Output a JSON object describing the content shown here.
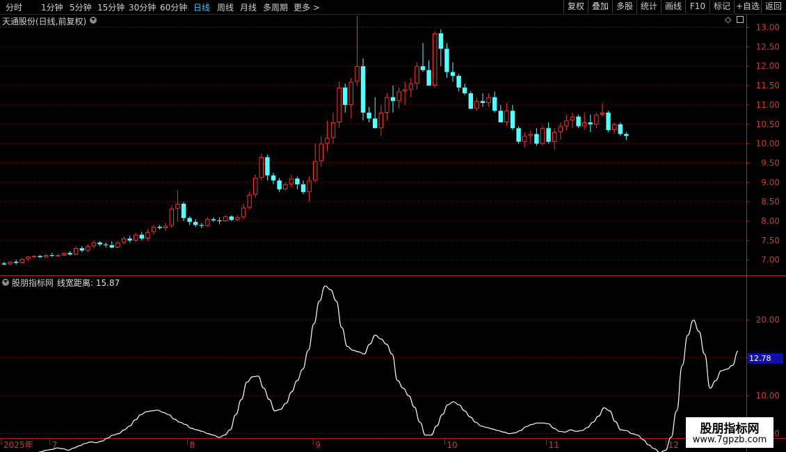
{
  "toolbar": {
    "periods": [
      "分时",
      "1分钟",
      "5分钟",
      "15分钟",
      "30分钟",
      "60分钟",
      "日线",
      "周线",
      "月线",
      "多周期",
      "更多 >"
    ],
    "active_period": "日线",
    "right_buttons": [
      "复权",
      "叠加",
      "多股",
      "统计",
      "画线",
      "F10",
      "标记",
      "+自选",
      "返回"
    ]
  },
  "main_panel": {
    "title": "天通股份(日线,前复权)",
    "collapse_icon": "chevron-down-icon",
    "icons": [
      "diamond-icon",
      "panel-toggle-icon"
    ]
  },
  "indicator_panel": {
    "title": "股朋指标网",
    "param_label": "线宽距离: 15.87",
    "badge_value": "12.78"
  },
  "watermark": {
    "title": "股朋指标网",
    "url": "www.7gpzb.com"
  },
  "colors": {
    "up": "#ff3232",
    "down": "#54ffff",
    "line": "#ffffff",
    "grid": "#8a1c1c",
    "axis": "#b32020",
    "label": "#cc3b3b",
    "badge_bg": "#1010a8"
  },
  "chart_data": [
    {
      "type": "candlestick",
      "title": "天通股份(日线,前复权)",
      "ylim": [
        6.6,
        13.35
      ],
      "y_ticks": [
        "7.00",
        "7.50",
        "8.00",
        "8.50",
        "9.00",
        "9.50",
        "10.00",
        "10.50",
        "11.00",
        "11.50",
        "12.00",
        "12.50",
        "13.00"
      ],
      "x_labels": [
        {
          "i": 0,
          "t": "2025年"
        },
        {
          "i": 8,
          "t": "7"
        },
        {
          "i": 31,
          "t": "8"
        },
        {
          "i": 52,
          "t": "9"
        },
        {
          "i": 74,
          "t": "10"
        },
        {
          "i": 91,
          "t": "11"
        },
        {
          "i": 111,
          "t": "12"
        }
      ],
      "ohlc": [
        [
          6.91,
          6.95,
          6.86,
          6.88
        ],
        [
          6.89,
          6.97,
          6.86,
          6.95
        ],
        [
          6.95,
          7.0,
          6.88,
          6.92
        ],
        [
          6.92,
          7.05,
          6.9,
          7.02
        ],
        [
          7.02,
          7.1,
          6.98,
          7.08
        ],
        [
          7.08,
          7.12,
          7.05,
          7.1
        ],
        [
          7.1,
          7.13,
          7.05,
          7.07
        ],
        [
          7.07,
          7.15,
          7.05,
          7.12
        ],
        [
          7.12,
          7.18,
          7.08,
          7.1
        ],
        [
          7.1,
          7.16,
          7.08,
          7.12
        ],
        [
          7.12,
          7.2,
          7.1,
          7.18
        ],
        [
          7.18,
          7.22,
          7.12,
          7.14
        ],
        [
          7.14,
          7.35,
          7.12,
          7.3
        ],
        [
          7.3,
          7.35,
          7.2,
          7.24
        ],
        [
          7.24,
          7.4,
          7.2,
          7.35
        ],
        [
          7.35,
          7.5,
          7.3,
          7.45
        ],
        [
          7.45,
          7.48,
          7.35,
          7.4
        ],
        [
          7.4,
          7.45,
          7.32,
          7.38
        ],
        [
          7.38,
          7.48,
          7.3,
          7.32
        ],
        [
          7.32,
          7.48,
          7.3,
          7.45
        ],
        [
          7.45,
          7.6,
          7.4,
          7.55
        ],
        [
          7.55,
          7.62,
          7.45,
          7.5
        ],
        [
          7.5,
          7.7,
          7.45,
          7.65
        ],
        [
          7.65,
          7.72,
          7.5,
          7.55
        ],
        [
          7.55,
          7.8,
          7.5,
          7.72
        ],
        [
          7.72,
          7.9,
          7.65,
          7.85
        ],
        [
          7.85,
          7.9,
          7.78,
          7.82
        ],
        [
          7.82,
          7.95,
          7.75,
          7.88
        ],
        [
          7.88,
          8.4,
          7.82,
          8.32
        ],
        [
          8.32,
          8.8,
          8.0,
          8.45
        ],
        [
          8.45,
          8.5,
          8.0,
          8.08
        ],
        [
          8.08,
          8.12,
          7.9,
          7.98
        ],
        [
          7.98,
          8.05,
          7.85,
          7.9
        ],
        [
          7.9,
          7.95,
          7.82,
          7.88
        ],
        [
          7.88,
          8.1,
          7.85,
          8.05
        ],
        [
          8.05,
          8.1,
          7.98,
          8.02
        ],
        [
          8.02,
          8.1,
          7.92,
          8.0
        ],
        [
          8.0,
          8.15,
          7.98,
          8.12
        ],
        [
          8.12,
          8.15,
          8.0,
          8.03
        ],
        [
          8.03,
          8.15,
          8.0,
          8.1
        ],
        [
          8.1,
          8.45,
          8.05,
          8.35
        ],
        [
          8.35,
          8.75,
          8.3,
          8.68
        ],
        [
          8.68,
          9.2,
          8.6,
          9.12
        ],
        [
          9.12,
          9.75,
          9.05,
          9.65
        ],
        [
          9.65,
          9.72,
          9.05,
          9.18
        ],
        [
          9.18,
          9.25,
          8.95,
          9.05
        ],
        [
          9.05,
          9.12,
          8.75,
          8.82
        ],
        [
          8.82,
          9.0,
          8.8,
          8.95
        ],
        [
          8.95,
          9.2,
          8.88,
          9.1
        ],
        [
          9.1,
          9.15,
          8.82,
          8.95
        ],
        [
          8.95,
          9.05,
          8.7,
          8.75
        ],
        [
          8.75,
          9.15,
          8.5,
          9.05
        ],
        [
          9.05,
          10.0,
          9.0,
          9.55
        ],
        [
          9.55,
          10.2,
          9.4,
          10.0
        ],
        [
          10.0,
          10.6,
          9.8,
          10.15
        ],
        [
          10.15,
          10.8,
          10.0,
          10.55
        ],
        [
          10.55,
          11.6,
          10.4,
          11.45
        ],
        [
          11.45,
          11.55,
          10.8,
          11.0
        ],
        [
          11.0,
          11.7,
          10.65,
          11.6
        ],
        [
          11.6,
          13.3,
          11.5,
          12.0
        ],
        [
          12.0,
          12.2,
          10.6,
          10.8
        ],
        [
          10.8,
          10.95,
          10.55,
          10.65
        ],
        [
          10.65,
          11.2,
          10.5,
          10.4
        ],
        [
          10.4,
          11.0,
          10.2,
          10.8
        ],
        [
          10.8,
          11.3,
          10.6,
          11.2
        ],
        [
          11.2,
          11.5,
          10.8,
          11.1
        ],
        [
          11.1,
          11.45,
          10.9,
          11.35
        ],
        [
          11.35,
          11.6,
          11.0,
          11.4
        ],
        [
          11.4,
          11.7,
          11.2,
          11.55
        ],
        [
          11.55,
          12.1,
          11.4,
          12.0
        ],
        [
          12.0,
          12.6,
          11.85,
          11.9
        ],
        [
          11.9,
          12.15,
          11.55,
          11.5
        ],
        [
          11.5,
          12.9,
          11.45,
          12.85
        ],
        [
          12.85,
          12.95,
          12.0,
          12.45
        ],
        [
          12.45,
          12.6,
          11.7,
          11.85
        ],
        [
          11.85,
          12.1,
          11.6,
          11.75
        ],
        [
          11.75,
          11.8,
          11.35,
          11.45
        ],
        [
          11.45,
          11.55,
          11.25,
          11.3
        ],
        [
          11.3,
          11.35,
          10.9,
          10.9
        ],
        [
          10.9,
          11.2,
          10.85,
          11.1
        ],
        [
          11.1,
          11.3,
          10.95,
          11.05
        ],
        [
          11.05,
          11.3,
          10.95,
          11.2
        ],
        [
          11.2,
          11.35,
          10.8,
          10.85
        ],
        [
          10.85,
          11.0,
          10.55,
          10.55
        ],
        [
          10.55,
          11.05,
          10.45,
          10.85
        ],
        [
          10.85,
          11.0,
          10.35,
          10.4
        ],
        [
          10.4,
          10.45,
          10.0,
          10.05
        ],
        [
          10.05,
          10.3,
          9.9,
          10.2
        ],
        [
          10.2,
          10.35,
          10.0,
          10.25
        ],
        [
          10.25,
          10.4,
          9.95,
          10.0
        ],
        [
          10.0,
          10.45,
          9.95,
          10.4
        ],
        [
          10.4,
          10.55,
          10.0,
          10.05
        ],
        [
          10.05,
          10.4,
          9.85,
          10.3
        ],
        [
          10.3,
          10.55,
          10.1,
          10.45
        ],
        [
          10.45,
          10.75,
          10.35,
          10.6
        ],
        [
          10.6,
          10.8,
          10.4,
          10.7
        ],
        [
          10.7,
          10.75,
          10.4,
          10.45
        ],
        [
          10.45,
          10.8,
          10.35,
          10.55
        ],
        [
          10.55,
          10.75,
          10.3,
          10.5
        ],
        [
          10.5,
          10.8,
          10.4,
          10.75
        ],
        [
          10.75,
          11.05,
          10.7,
          10.8
        ],
        [
          10.8,
          10.85,
          10.3,
          10.35
        ],
        [
          10.35,
          10.55,
          10.25,
          10.5
        ],
        [
          10.5,
          10.55,
          10.2,
          10.25
        ],
        [
          10.25,
          10.3,
          10.1,
          10.2
        ]
      ]
    },
    {
      "type": "line",
      "title": "股朋指标网",
      "ylim": [
        4.5,
        25.8
      ],
      "y_ticks": [
        "5.00",
        "10.00",
        "15.00",
        "20.00"
      ],
      "x_labels": [
        {
          "i": 0,
          "t": "2025年"
        },
        {
          "i": 8,
          "t": "7"
        },
        {
          "i": 31,
          "t": "8"
        },
        {
          "i": 52,
          "t": "9"
        },
        {
          "i": 74,
          "t": "10"
        },
        {
          "i": 91,
          "t": "11"
        },
        {
          "i": 111,
          "t": "12"
        }
      ],
      "values": [
        1.8,
        1.3,
        1.4,
        1.9,
        2.3,
        2.4,
        2.2,
        2.6,
        2.8,
        2.9,
        3.1,
        3.0,
        2.8,
        3.1,
        3.4,
        3.7,
        3.9,
        3.8,
        4.0,
        4.4,
        4.8,
        5.0,
        5.5,
        6.0,
        6.8,
        7.5,
        7.9,
        8.0,
        8.1,
        7.8,
        7.5,
        6.9,
        6.5,
        6.2,
        5.7,
        5.5,
        5.3,
        5.0,
        4.8,
        4.5,
        4.8,
        5.5,
        7.5,
        9.5,
        11.8,
        12.5,
        12.6,
        11.0,
        9.5,
        8.0,
        8.2,
        9.0,
        10.5,
        12.0,
        13.5,
        16.0,
        19.5,
        22.5,
        24.5,
        24.0,
        22.5,
        19.0,
        16.5,
        16.0,
        15.8,
        15.5,
        16.8,
        18.0,
        17.5,
        16.8,
        15.5,
        12.0,
        11.0,
        10.0,
        8.5,
        6.5,
        4.8,
        4.8,
        6.0,
        7.5,
        8.8,
        9.2,
        8.8,
        8.0,
        7.2,
        6.5,
        6.0,
        5.8,
        5.6,
        5.4,
        5.2,
        5.0,
        5.1,
        5.4,
        5.9,
        6.2,
        6.4,
        6.4,
        6.3,
        5.7,
        5.3,
        5.2,
        5.5,
        5.3,
        5.4,
        5.8,
        6.5,
        7.3,
        8.4,
        8.0,
        6.6,
        5.5,
        5.4,
        5.0,
        4.8,
        4.2,
        3.5,
        3.0,
        2.5,
        2.8,
        4.5,
        8.0,
        14.0,
        18.0,
        20.0,
        18.5,
        15.5,
        11.0,
        12.0,
        13.3,
        13.5,
        14.0,
        15.87
      ]
    }
  ]
}
